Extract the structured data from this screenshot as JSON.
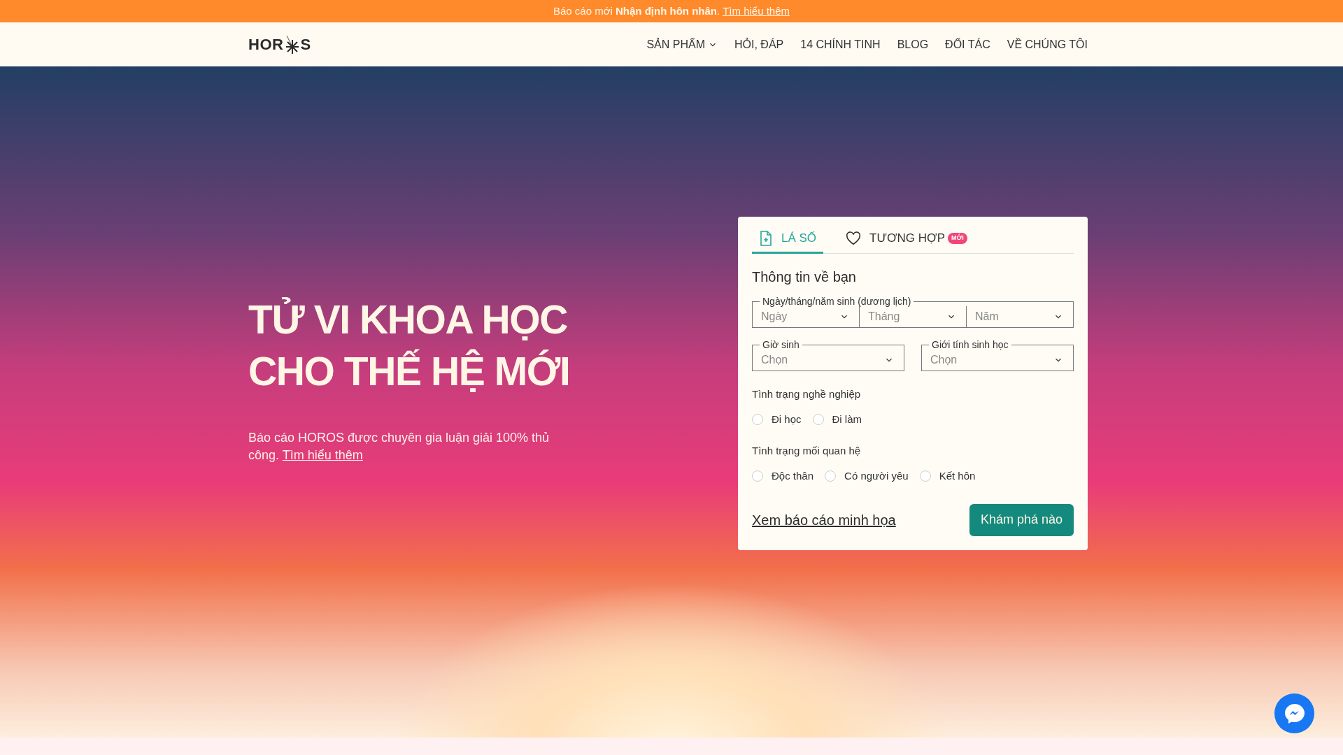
{
  "announcement": {
    "text": "Báo cáo mới **Nhận định hôn nhân**.",
    "link": "Tìm hiểu thêm"
  },
  "nav": {
    "logo": {
      "left": "HOR",
      "right": "S"
    },
    "items": [
      {
        "label": "SẢN PHẨM",
        "dropdown": true
      },
      {
        "label": "HỎI, ĐÁP",
        "dropdown": false
      },
      {
        "label": "14 CHÍNH TINH",
        "dropdown": false
      },
      {
        "label": "BLOG",
        "dropdown": false
      },
      {
        "label": "ĐỐI TÁC",
        "dropdown": false
      },
      {
        "label": "VỀ CHÚNG TÔI",
        "dropdown": false
      }
    ]
  },
  "hero": {
    "title": [
      "TỬ VI KHOA HỌC",
      "CHO THẾ HỆ MỚI"
    ],
    "description": "Báo cáo HOROS được chuyên gia luận giải 100% thủ công.",
    "link": "Tìm hiểu thêm"
  },
  "form": {
    "tabs": [
      {
        "label": "LÁ SỐ",
        "kind": "document",
        "selected": true
      },
      {
        "label": "TƯƠNG HỢP",
        "kind": "heart",
        "selected": false,
        "badge": "MỚI"
      }
    ],
    "heading": "Thông tin về bạn",
    "date": {
      "legend": "Ngày/tháng/năm sinh (dương lịch)",
      "selects": [
        {
          "placeholder": "Ngày"
        },
        {
          "placeholder": "Tháng"
        },
        {
          "placeholder": "Năm"
        }
      ]
    },
    "selects": [
      {
        "legend": "Giờ sinh",
        "placeholder": "Chọn"
      },
      {
        "legend": "Giới tính sinh học",
        "placeholder": "Chọn"
      }
    ],
    "radio_groups": [
      {
        "label": "Tình trạng nghề nghiệp",
        "options": [
          {
            "label": "Đi học",
            "selected": false
          },
          {
            "label": "Đi làm",
            "selected": false
          }
        ]
      },
      {
        "label": "Tình trạng mối quan hệ",
        "options": [
          {
            "label": "Độc thân",
            "selected": false
          },
          {
            "label": "Có người yêu",
            "selected": false
          },
          {
            "label": "Kết hôn",
            "selected": false
          }
        ]
      }
    ],
    "sample_link": "Xem báo cáo minh họa",
    "submit": "Khám phá nào"
  }
}
